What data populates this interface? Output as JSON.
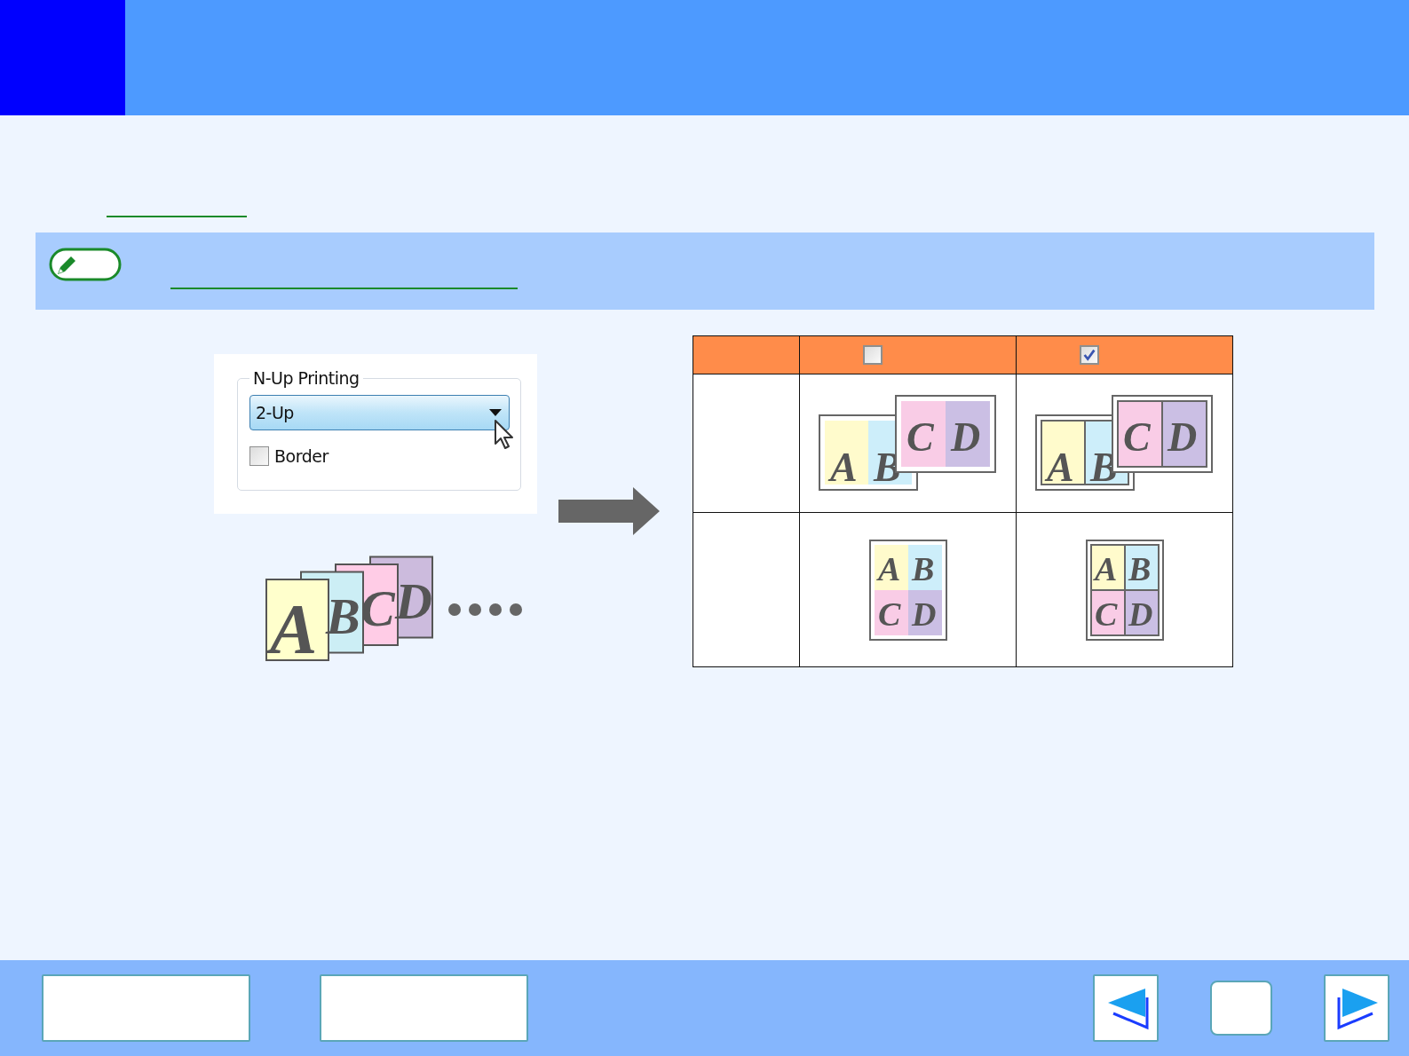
{
  "dialog": {
    "group_label": "N-Up Printing",
    "dropdown_value": "2-Up",
    "checkbox": {
      "label": "Border",
      "checked": false
    }
  },
  "sample_pages": [
    "A",
    "B",
    "C",
    "D"
  ],
  "table": {
    "header_checkboxes": [
      {
        "checked": false
      },
      {
        "checked": true
      }
    ],
    "rows": [
      {
        "kind": "two-up",
        "cells": [
          {
            "border": false,
            "letters": [
              "A",
              "B",
              "C",
              "D"
            ]
          },
          {
            "border": true,
            "letters": [
              "A",
              "B",
              "C",
              "D"
            ]
          }
        ]
      },
      {
        "kind": "four-up",
        "cells": [
          {
            "border": false,
            "letters": [
              "A",
              "B",
              "C",
              "D"
            ]
          },
          {
            "border": true,
            "letters": [
              "A",
              "B",
              "C",
              "D"
            ]
          }
        ]
      }
    ]
  }
}
